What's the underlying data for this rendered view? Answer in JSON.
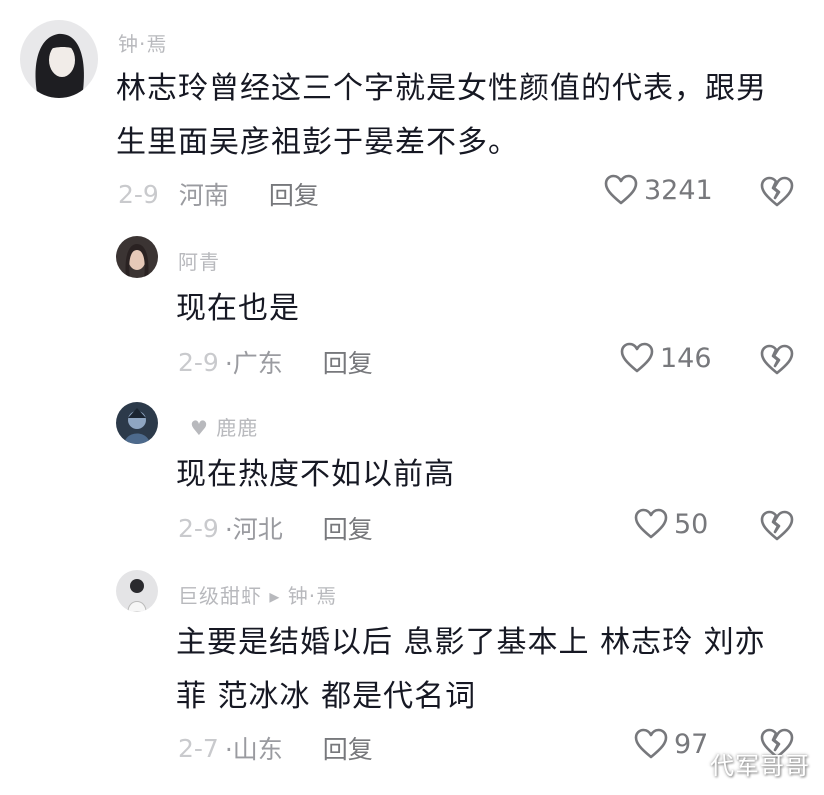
{
  "comments": [
    {
      "user": "钟·焉",
      "text": "林志玲曾经这三个字就是女性颜值的代表，跟男生里面吴彦祖彭于晏差不多。",
      "text_line1": "林志玲曾经这三个字就是女性颜值的代表，跟男",
      "text_line2": "生里面吴彦祖彭于晏差不多。",
      "date": "2-9",
      "location": "河南",
      "reply": "回复",
      "likes": "3241"
    },
    {
      "user": "阿青",
      "text": "现在也是",
      "date": "2-9",
      "location": "·广东",
      "reply": "回复",
      "likes": "146"
    },
    {
      "user": "♥ 鹿鹿",
      "text": "现在热度不如以前高",
      "date": "2-9",
      "location": "·河北",
      "reply": "回复",
      "likes": "50"
    },
    {
      "user": "巨级甜虾 ▸ 钟·焉",
      "text": "主要是结婚以后 息影了基本上 林志玲 刘亦菲 范冰冰 都是代名词",
      "text_line1": "主要是结婚以后 息影了基本上 林志玲 刘亦",
      "text_line2": "菲 范冰冰 都是代名词",
      "date": "2-7",
      "location": "·山东",
      "reply": "回复",
      "likes": "97"
    }
  ],
  "watermark": "代军哥哥",
  "colors": {
    "text": "#161823",
    "meta": "#9a9ba0",
    "icon": "#77787c"
  },
  "icons": [
    "heart-outline-icon",
    "broken-heart-icon"
  ]
}
